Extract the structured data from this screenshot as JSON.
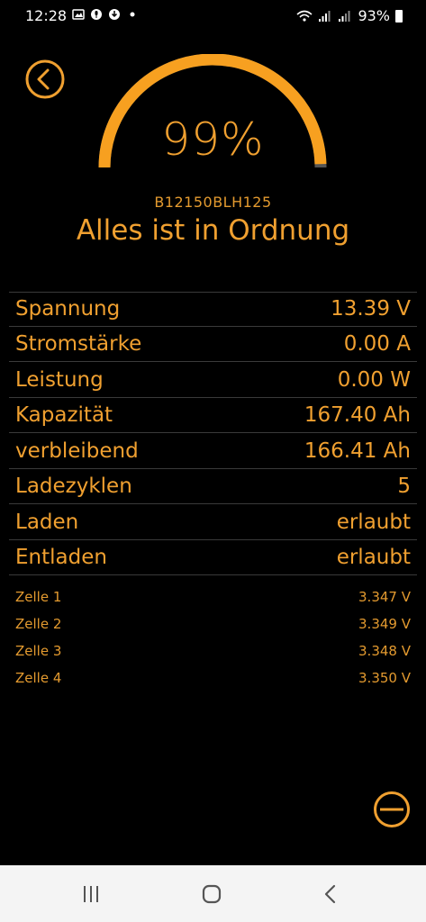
{
  "status_bar": {
    "time": "12:28",
    "battery_percent": "93%"
  },
  "gauge": {
    "percent_label": "99%",
    "level": 0.99,
    "color": "#f7a020"
  },
  "battery": {
    "device_id": "B12150BLH125",
    "status_message": "Alles ist in Ordnung"
  },
  "details": [
    {
      "label": "Spannung",
      "value": "13.39 V"
    },
    {
      "label": "Stromstärke",
      "value": "0.00 A"
    },
    {
      "label": "Leistung",
      "value": "0.00 W"
    },
    {
      "label": "Kapazität",
      "value": "167.40 Ah"
    },
    {
      "label": "verbleibend",
      "value": "166.41 Ah"
    },
    {
      "label": "Ladezyklen",
      "value": "5"
    },
    {
      "label": "Laden",
      "value": "erlaubt"
    },
    {
      "label": "Entladen",
      "value": "erlaubt"
    }
  ],
  "cells": [
    {
      "label": "Zelle 1",
      "value": "3.347 V"
    },
    {
      "label": "Zelle 2",
      "value": "3.349 V"
    },
    {
      "label": "Zelle 3",
      "value": "3.348 V"
    },
    {
      "label": "Zelle 4",
      "value": "3.350 V"
    }
  ],
  "colors": {
    "accent": "#f0a030",
    "background": "#000000"
  }
}
